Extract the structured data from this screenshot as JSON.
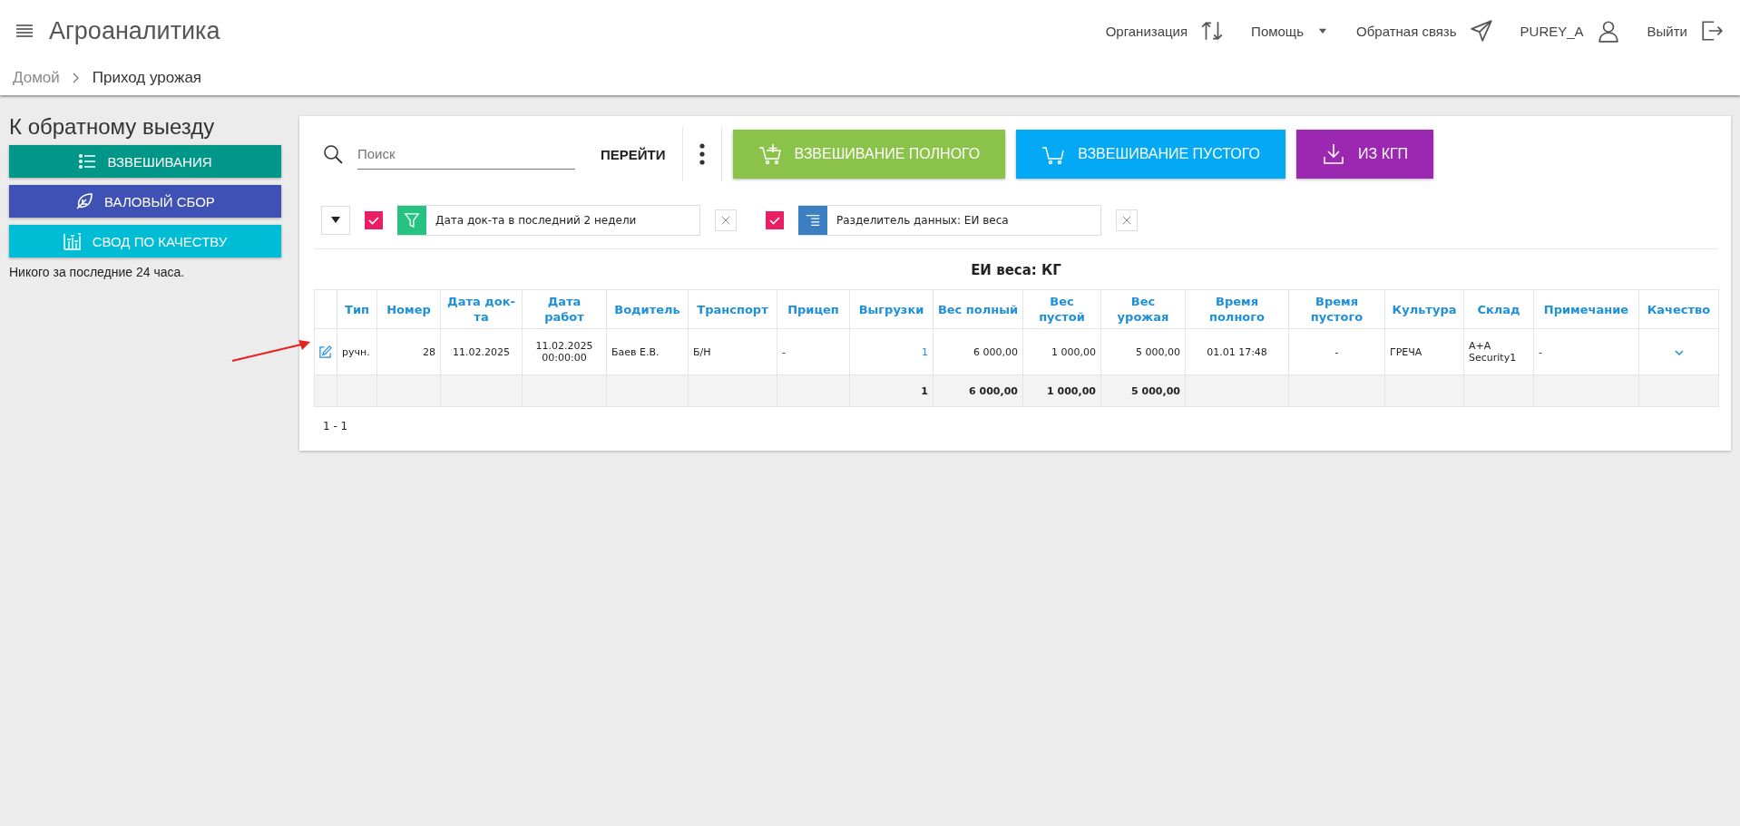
{
  "header": {
    "app_title": "Агроаналитика",
    "nav": [
      {
        "label": "Организация",
        "kind": "swap"
      },
      {
        "label": "Помощь",
        "kind": "dropdown"
      },
      {
        "label": "Обратная связь",
        "kind": "send"
      },
      {
        "label": "PUREY_A",
        "kind": "user"
      },
      {
        "label": "Выйти",
        "kind": "logout"
      }
    ]
  },
  "breadcrumbs": [
    {
      "label": "Домой",
      "selected": false
    },
    {
      "label": "Приход урожая",
      "selected": true
    }
  ],
  "sidebar": {
    "title": "К обратному выезду",
    "buttons": [
      {
        "label": "ВЗВЕШИВАНИЯ",
        "kind": "list",
        "color": "#009688"
      },
      {
        "label": "ВАЛОВЫЙ СБОР",
        "kind": "leaf",
        "color": "#3f51b5"
      },
      {
        "label": "СВОД ПО КАЧЕСТВУ",
        "kind": "scales",
        "color": "#00bcd4"
      }
    ],
    "note": "Никого за последние 24 часа."
  },
  "toolbar": {
    "search": {
      "placeholder": "Поиск"
    },
    "go_label": "ПЕРЕЙТИ",
    "actions": [
      {
        "label": "ВЗВЕШИВАНИЕ ПОЛНОГО",
        "kind": "cart-plus",
        "color": "#8bc34a"
      },
      {
        "label": "ВЗВЕШИВАНИЕ ПУСТОГО",
        "kind": "cart",
        "color": "#03a9f4"
      },
      {
        "label": "ИЗ КГП",
        "kind": "download",
        "color": "#9c27b0"
      }
    ]
  },
  "filters": [
    {
      "label": "Дата док-та в последний 2 недели",
      "checked": true,
      "kind": "funnel",
      "color": "#26c281"
    },
    {
      "label": "Разделитель данных: ЕИ веса",
      "checked": true,
      "kind": "lines",
      "color": "#3a7fc1"
    }
  ],
  "table": {
    "caption": "ЕИ веса: КГ",
    "columns": [
      "Тип",
      "Номер",
      "Дата док-та",
      "Дата работ",
      "Водитель",
      "Транспорт",
      "Прицеп",
      "Выгрузки",
      "Вес полный",
      "Вес пустой",
      "Вес урожая",
      "Время полного",
      "Время пустого",
      "Культура",
      "Склад",
      "Примечание",
      "Качество"
    ],
    "rows": [
      {
        "cells": [
          "ручн.",
          "28",
          "11.02.2025",
          "11.02.2025 00:00:00",
          "Баев Е.В.",
          "Б/Н",
          "-",
          "1",
          "6 000,00",
          "1 000,00",
          "5 000,00",
          "01.01 17:48",
          "-",
          "ГРЕЧА",
          "A+A Security1",
          "-"
        ]
      }
    ],
    "totals": {
      "unloads": "1",
      "weight_full": "6 000,00",
      "weight_empty": "1 000,00",
      "weight_harvest": "5 000,00"
    }
  },
  "pagination": "1 - 1"
}
